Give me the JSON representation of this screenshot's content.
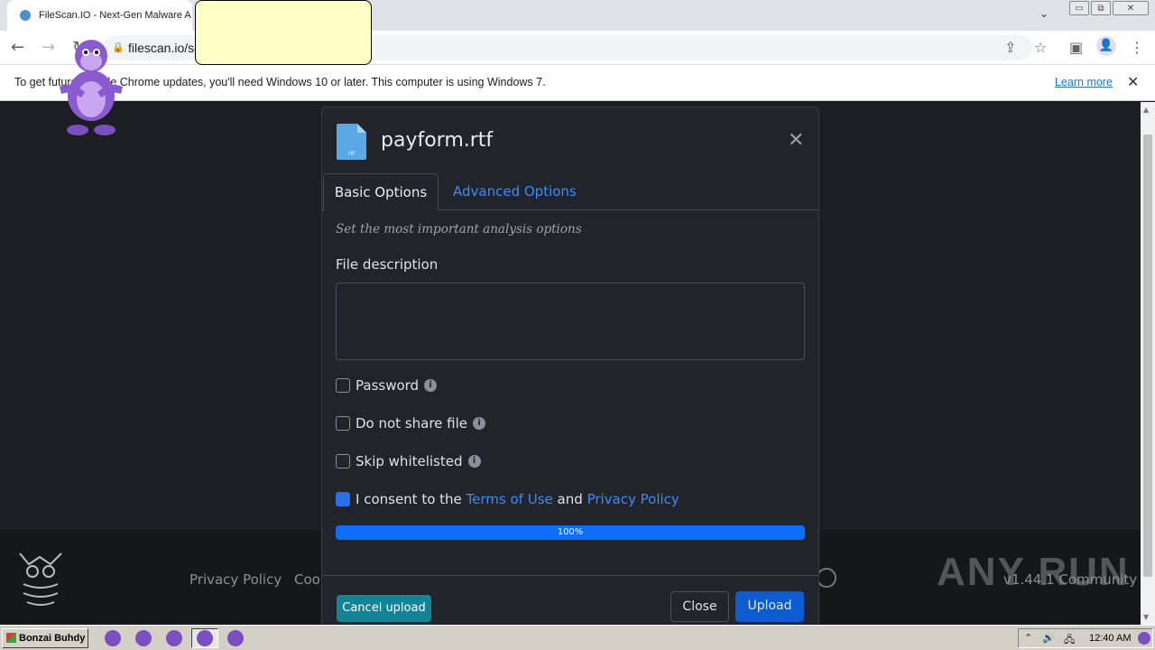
{
  "browser": {
    "tab_title": "FileScan.IO - Next-Gen Malware A",
    "url": "filescan.io/sc",
    "controls": {
      "minimize": "▭",
      "restore": "⧉",
      "close": "✕",
      "tab_list": "⌄"
    }
  },
  "infobar": {
    "message": "To get future Google Chrome updates, you'll need Windows 10 or later. This computer is using Windows 7.",
    "learn_more": "Learn more"
  },
  "modal": {
    "file_name": "payform.rtf",
    "file_ext_badge": "rtf",
    "tabs": [
      "Basic Options",
      "Advanced Options"
    ],
    "active_tab": "Basic Options",
    "hint": "Set the most important analysis options",
    "description_label": "File description",
    "description_value": "",
    "checkboxes": [
      {
        "label": "Password",
        "checked": false,
        "info": true
      },
      {
        "label": "Do not share file",
        "checked": false,
        "info": true
      },
      {
        "label": "Skip whitelisted",
        "checked": false,
        "info": true
      }
    ],
    "consent": {
      "checked": true,
      "prefix": "I consent to the",
      "terms": "Terms of Use",
      "and": "and",
      "privacy": "Privacy Policy"
    },
    "progress": {
      "value": 100,
      "label": "100%"
    },
    "buttons": {
      "cancel": "Cancel upload",
      "close": "Close",
      "upload": "Upload"
    }
  },
  "footer": {
    "links": [
      "Privacy Policy",
      "Cook"
    ],
    "version": "v1.44.1 Community",
    "watermark": "ANY RUN"
  },
  "taskbar": {
    "start_label": "Bonzai Buhdy",
    "time": "12:40 AM"
  },
  "colors": {
    "accent": "#0d6efd",
    "link": "#3d8bfd",
    "cancel_button": "#138496",
    "modal_bg": "#21242a"
  }
}
